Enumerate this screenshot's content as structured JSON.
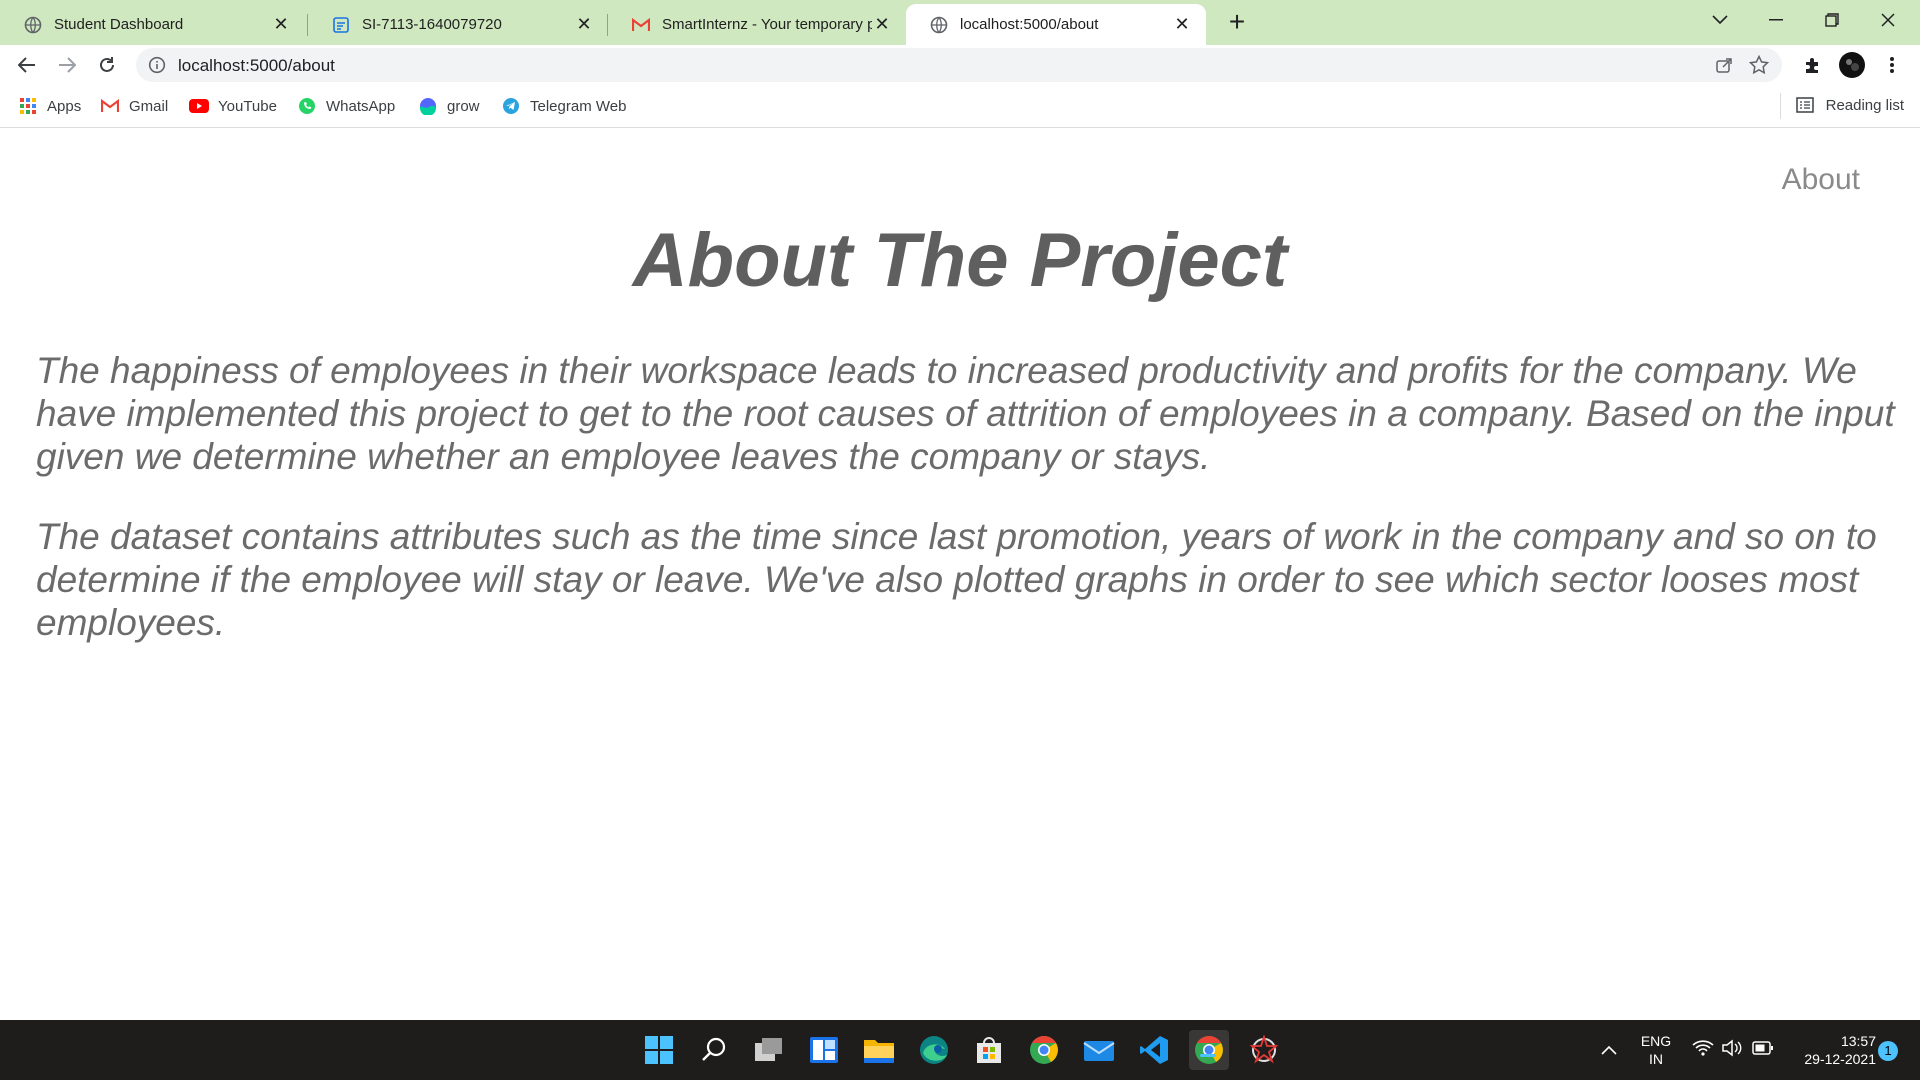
{
  "tabs": [
    {
      "label": "Student Dashboard",
      "icon": "globe-icon"
    },
    {
      "label": "SI-7113-1640079720",
      "icon": "form-icon"
    },
    {
      "label": "SmartInternz - Your temporary p",
      "icon": "gmail-icon"
    },
    {
      "label": "localhost:5000/about",
      "icon": "globe-icon"
    }
  ],
  "address_bar": {
    "url": "localhost:5000/about"
  },
  "bookmarks": [
    {
      "label": "Apps",
      "icon": "apps-grid-icon"
    },
    {
      "label": "Gmail",
      "icon": "gmail-icon"
    },
    {
      "label": "YouTube",
      "icon": "youtube-icon"
    },
    {
      "label": "WhatsApp",
      "icon": "whatsapp-icon"
    },
    {
      "label": "grow",
      "icon": "grow-icon"
    },
    {
      "label": "Telegram Web",
      "icon": "telegram-icon"
    }
  ],
  "reading_list": {
    "label": "Reading list"
  },
  "page": {
    "nav_about": "About",
    "title": "About The Project",
    "paragraphs": [
      "The happiness of employees in their workspace leads to increased productivity and profits for the company. We have implemented this project to get to the root causes of attrition of employees in a company. Based on the input given we determine whether an employee leaves the company or stays.",
      "The dataset contains attributes such as the time since last promotion, years of work in the company and so on to determine if the employee will stay or leave. We've also plotted graphs in order to see which sector looses most employees."
    ]
  },
  "taskbar": {
    "apps": [
      "windows-start-icon",
      "search-icon",
      "task-view-icon",
      "widgets-icon",
      "file-explorer-icon",
      "edge-icon",
      "store-icon",
      "chrome-icon",
      "mail-icon",
      "vscode-icon",
      "chrome-icon",
      "app-icon"
    ],
    "lang_primary": "ENG",
    "lang_secondary": "IN",
    "time": "13:57",
    "date": "29-12-2021",
    "notifications": "1"
  },
  "colors": {
    "tabstrip": "#cfe8c0",
    "taskbar": "#1f1d1c",
    "text_gray": "#6b6b6b"
  }
}
